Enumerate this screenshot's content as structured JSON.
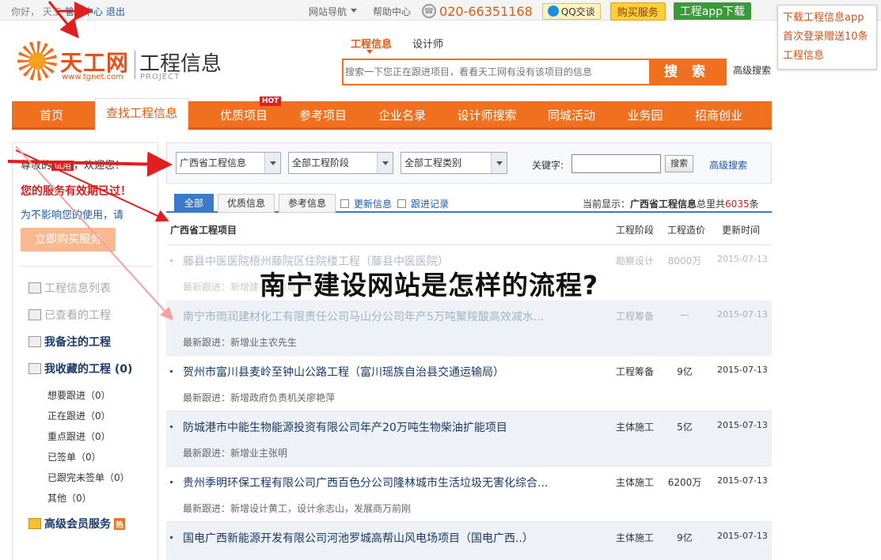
{
  "topbar": {
    "greeting": "你好，",
    "user": "天工",
    "admin": "管理中心",
    "logout": "退出",
    "site_nav": "网站导航",
    "help": "帮助中心",
    "phone": "020-66351168",
    "qq": "QQ交谈",
    "buy": "购买服务",
    "app": "工程app下载"
  },
  "popup": {
    "line1": "下载工程信息app",
    "line2": "首次登录赠送10条",
    "line3": "工程信息"
  },
  "logo": {
    "brand": "天工网",
    "url": "www.tgnet.com",
    "section": "工程信息",
    "section_en": "PROJECT"
  },
  "search": {
    "tabs": [
      "工程信息",
      "设计师"
    ],
    "placeholder": "搜索一下您正在跟进项目，看看天工网有没有该项目的信息",
    "button": "搜 索",
    "advanced": "高级搜索"
  },
  "nav": {
    "items": [
      "首页",
      "查找工程信息",
      "优质项目",
      "参考项目",
      "企业名录",
      "设计师搜索",
      "同城活动",
      "业务园",
      "招商创业"
    ],
    "hot": "HOT"
  },
  "sidebar": {
    "welcome_pre": "尊敬的",
    "trial": "试用",
    "welcome_post": "，欢迎您！",
    "expired": "您的服务有效期已过！",
    "notaffect": "为不影响您的使用，请",
    "buynow": "立即购买服务",
    "menu": [
      "工程信息列表",
      "已查看的工程",
      "我备注的工程",
      "我收藏的工程 (0)"
    ],
    "sub": [
      "想要跟进（0）",
      "正在跟进（0）",
      "重点跟进（0）",
      "已签单（0）",
      "已跟完未签单（0）",
      "其他（0）"
    ],
    "vip": "高级会员服务",
    "vip_badge": "热"
  },
  "filter": {
    "province": "广西省工程信息",
    "stage": "全部工程阶段",
    "category": "全部工程类别",
    "keyword_label": "关键字:",
    "keyword_value": "",
    "search_btn": "搜索",
    "advanced": "高级搜索"
  },
  "list_tabs": {
    "tabs": [
      "全部",
      "优质信息",
      "参考信息"
    ],
    "checks": [
      "更新信息",
      "跟进记录"
    ],
    "current_pre": "当前显示：",
    "current_name": "广西省工程信息",
    "current_mid": "总里共",
    "current_count": "6035",
    "current_post": "条"
  },
  "table": {
    "headers": [
      "广西省工程项目",
      "工程阶段",
      "工程造价",
      "更新时间"
    ],
    "rows": [
      {
        "title": "藤县中医医院梧州藤院区住院楼工程（藤县中医医院）",
        "follow": "最新跟进：新增建设单位联系人",
        "stage": "勘察设计",
        "price": "8000万",
        "date": "2015-07-13"
      },
      {
        "title": "南宁市雨润建材化工有限责任公司马山分公司年产5万吨聚羧酸高效减水...",
        "follow": "最新跟进：新增业主农先生",
        "stage": "工程筹备",
        "price": "—",
        "date": "2015-07-13"
      },
      {
        "title": "贺州市富川县麦岭至钟山公路工程（富川瑶族自治县交通运输局）",
        "follow": "最新跟进：新增政府负责机关廖艳萍",
        "stage": "工程筹备",
        "price": "9亿",
        "date": "2015-07-13"
      },
      {
        "title": "防城港市中能生物能源投资有限公司年产20万吨生物柴油扩能项目",
        "follow": "最新跟进：新增业主张明",
        "stage": "主体施工",
        "price": "5亿",
        "date": "2015-07-13"
      },
      {
        "title": "贵州季明环保工程有限公司广西百色分公司隆林城市生活垃圾无害化综合...",
        "follow": "最新跟进：新增设计黄工，设计余志山，发展商万前刚",
        "stage": "主体施工",
        "price": "6200万",
        "date": "2015-07-13"
      },
      {
        "title": "国电广西新能源开发有限公司河池罗城高帮山风电场项目（国电广西..）",
        "follow": "",
        "stage": "主体施工",
        "price": "9亿",
        "date": "2015-07-13"
      }
    ]
  },
  "overlay_title": "南宁建设网站是怎样的流程?",
  "colors": {
    "accent": "#f07020",
    "link": "#1a5ca8",
    "arrow": "#e02020"
  }
}
